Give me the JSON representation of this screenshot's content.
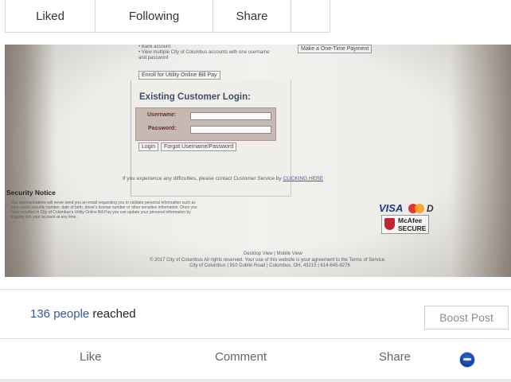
{
  "tabs": [
    "Liked",
    "Following",
    "Share",
    ""
  ],
  "photo": {
    "bullets": [
      "• Bank account",
      "• View multiple City of Columbus accounts with one username",
      "   and password"
    ],
    "email_button": "Enroll for Utility Online Bill Pay",
    "one_time_payment": "Make a One-Time Payment",
    "login_title": "Existing Customer Login:",
    "username_label": "Username:",
    "password_label": "Password:",
    "login_button": "Login",
    "forgot_button": "Forgot Username/Password",
    "difficulty_text": "If you experience any difficulties, please contact Customer Service by",
    "clicking_here": "CLICKING HERE",
    "security_title": "Security Notice",
    "security_lines": [
      "Our representatives will never send you an email requesting you to validate personal information such as",
      "your social security number, date of birth, driver's license number or other sensitive information. Once you",
      "have enrolled in City of Columbus's Utility Online Bill Pay you can update your personal information by",
      "logging into your account at any time."
    ],
    "visa": "VISA",
    "discover": "D",
    "mcafee_top": "McAfee",
    "mcafee_bottom": "SECURE",
    "footer_views": "Desktop View | Mobile View",
    "footer_line1": "© 2017 City of Columbus All rights reserved. Your use of this website is your agreement to the Terms of Service.",
    "footer_line2": "City of Columbus | 910 Dublin Road | Columbus, OH, 43215 | 614-645-8276"
  },
  "stats": {
    "reached_count": "136 people",
    "reached_text": " reached",
    "boost_label": "Boost Post"
  },
  "actions": {
    "like": "Like",
    "comment": "Comment",
    "share": "Share"
  },
  "colors": {
    "link": "#365899",
    "border": "#dddfe2",
    "muted": "#606770"
  }
}
